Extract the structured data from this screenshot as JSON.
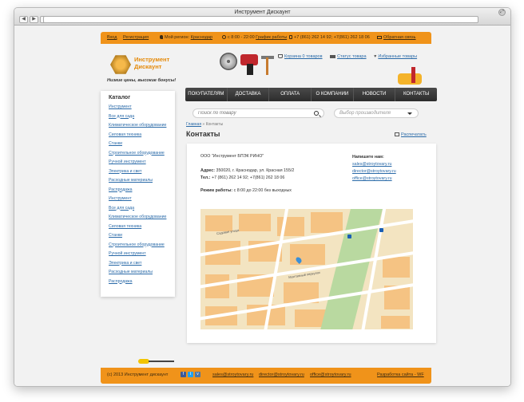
{
  "browser": {
    "window_title": "Инструмент Дискаунт"
  },
  "topbar": {
    "login": "Вход",
    "register": "Регистрация",
    "region_label": "Мой регион:",
    "region_value": "Краснодар",
    "hours": "с 8:00 - 22:00",
    "schedule_link": "График работы",
    "phones": "+7 (861) 262 14 92; +7(861) 262 18 06",
    "feedback": "Обратная связь"
  },
  "logo": {
    "line1": "Инструмент",
    "line2": "Дискаунт",
    "slogan": "Низкие цены, высокие бонусы!"
  },
  "header_links": {
    "cart": "Корзина 0 товаров",
    "order_status": "Статус товара",
    "favorites": "Избранные товары"
  },
  "menu": [
    "ПОКУПАТЕЛЯМ",
    "ДОСТАВКА",
    "ОПЛАТА",
    "О КОМПАНИИ",
    "НОВОСТИ",
    "КОНТАКТЫ"
  ],
  "search": {
    "placeholder": "Поиск по товару",
    "vendor_placeholder": "Выбор производителя"
  },
  "sidebar": {
    "title": "Каталог",
    "items": [
      "Инструмент",
      "Все для сада",
      "Климатическое оборудование",
      "Силовая техника",
      "Станки",
      "Строительное оборудование",
      "Ручной инструмент",
      "Электрика и свет",
      "Расходные материалы",
      "Распродажа",
      "Инструмент",
      "Все для сада",
      "Климатическое оборудование",
      "Силовая техника",
      "Станки",
      "Строительное оборудование",
      "Ручной инструмент",
      "Электрика и свет",
      "Расходные материалы",
      "Распродажа"
    ]
  },
  "breadcrumb": {
    "home": "Главная",
    "current": "» Контакты"
  },
  "page": {
    "title": "Контакты",
    "print": "Распечатать"
  },
  "contacts": {
    "company": "ООО \"Инструмент БПЭК РИНО\"",
    "address_label": "Адрес:",
    "address": "350020, г. Краснодар, ул. Красная 155/2",
    "phone_label": "Тел.:",
    "phone": "+7 (861) 262 14 92; +7(861) 262 18 06",
    "hours_label": "Режим работы:",
    "hours": "с 8:00 до 22:00 без выходных",
    "write_label": "Напишите нам:",
    "emails": [
      "sales@stroytovary.ru",
      "director@stroytovary.ru",
      "office@stroytovary.ru"
    ]
  },
  "map": {
    "street1": "Садовая улица",
    "street2": "Монтажный переулок"
  },
  "footer": {
    "copyright": "(с) 2013 Инструмент дискаунт",
    "social": [
      "f",
      "t",
      "v"
    ],
    "emails": [
      "sales@stroytovary.ru",
      "director@stroytovary.ru",
      "office@stroytovary.ru"
    ],
    "developer": "Разработка сайта - WF"
  }
}
